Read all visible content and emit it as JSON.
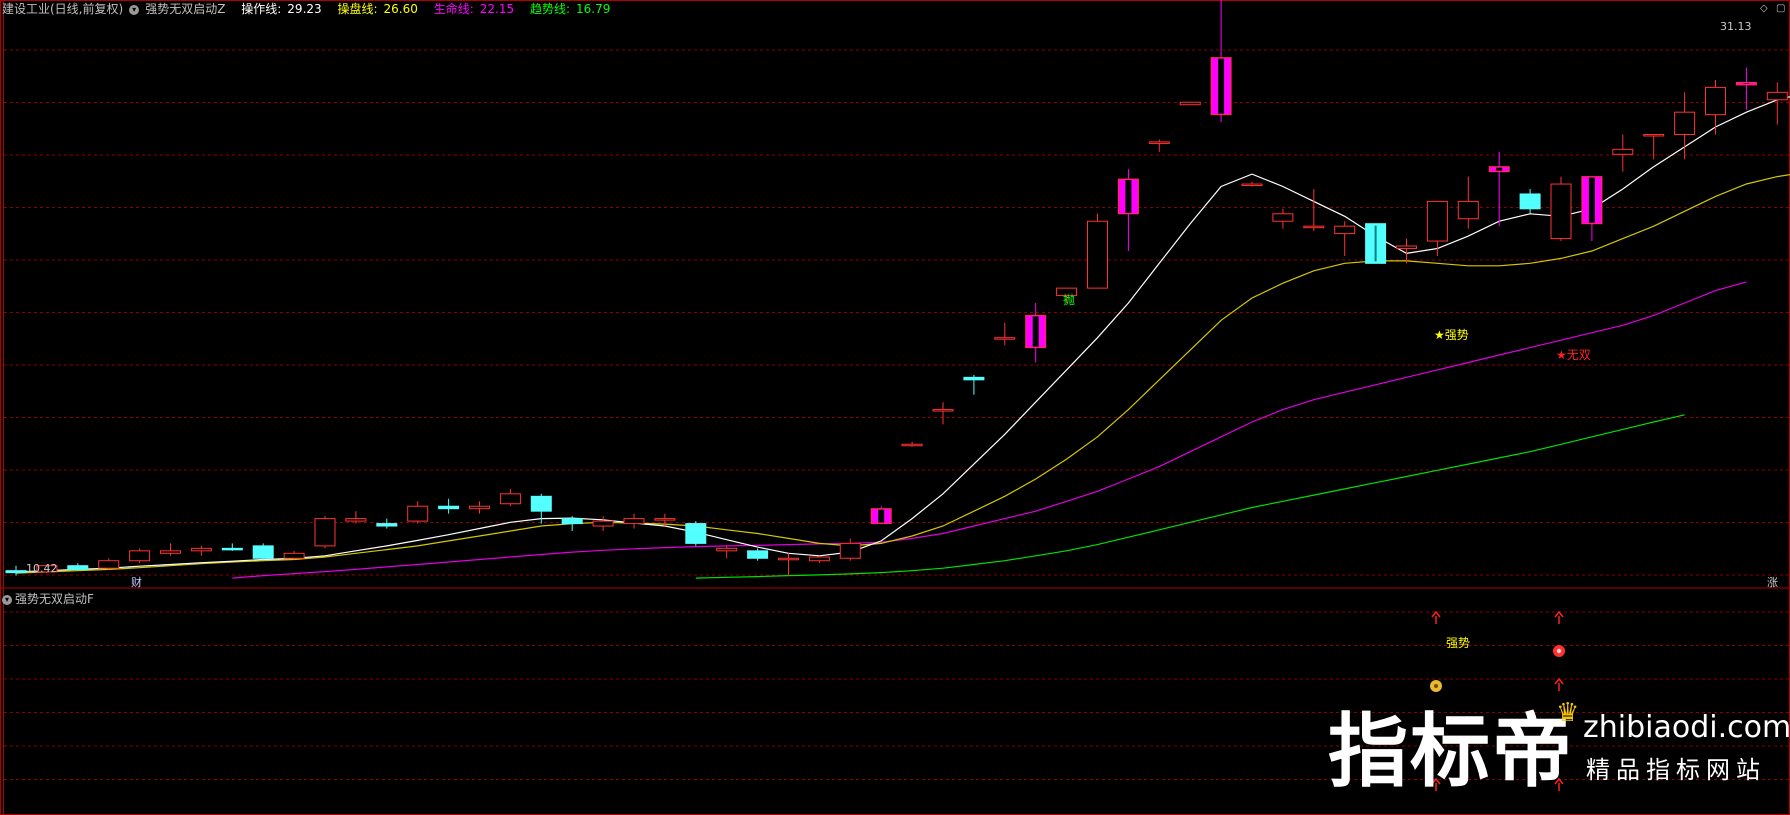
{
  "header": {
    "stock_title": "建设工业(日线,前复权)",
    "indicator_name": "强势无双启动Z",
    "lines": [
      {
        "label": "操作线:",
        "value": "29.23",
        "color": "#ffffff"
      },
      {
        "label": "操盘线:",
        "value": "26.60",
        "color": "#ffff00"
      },
      {
        "label": "生命线:",
        "value": "22.15",
        "color": "#ff00ff"
      },
      {
        "label": "趋势线:",
        "value": "16.79",
        "color": "#00ff00"
      }
    ]
  },
  "price_labels": {
    "high": "31.13",
    "low": "10.42"
  },
  "markers": {
    "cai": "财",
    "zhang": "涨",
    "pao": "抛",
    "qiangshi": "★强势",
    "wushuang": "★无双"
  },
  "sub_panel": {
    "title": "强势无双启动F",
    "qiangshi_label": "强势"
  },
  "watermark": {
    "big": "指标帝",
    "url": "zhibiaodi.com",
    "sub": "精品指标网站"
  },
  "colors": {
    "up": "#ff3232",
    "down": "#54ffff",
    "special": "#ff00ff",
    "grid": "#8b0000",
    "border": "#b00000"
  },
  "chart_data": {
    "type": "candlestick",
    "ohlc": [
      [
        10.5,
        10.7,
        10.3,
        10.42
      ],
      [
        10.45,
        10.75,
        10.4,
        10.7
      ],
      [
        10.7,
        10.8,
        10.5,
        10.55
      ],
      [
        10.6,
        11.0,
        10.55,
        10.9
      ],
      [
        10.9,
        11.4,
        10.8,
        11.3
      ],
      [
        11.2,
        11.6,
        11.1,
        11.3
      ],
      [
        11.3,
        11.5,
        11.1,
        11.4
      ],
      [
        11.4,
        11.6,
        11.3,
        11.35
      ],
      [
        11.5,
        11.6,
        10.9,
        11.0
      ],
      [
        11.0,
        11.3,
        10.95,
        11.2
      ],
      [
        11.5,
        12.7,
        11.4,
        12.6
      ],
      [
        12.5,
        12.9,
        12.4,
        12.6
      ],
      [
        12.4,
        12.6,
        12.2,
        12.3
      ],
      [
        12.5,
        13.3,
        12.4,
        13.1
      ],
      [
        13.1,
        13.4,
        12.8,
        13.0
      ],
      [
        13.0,
        13.3,
        12.8,
        13.1
      ],
      [
        13.2,
        13.8,
        13.1,
        13.6
      ],
      [
        13.5,
        13.6,
        12.4,
        12.9
      ],
      [
        12.6,
        12.7,
        12.1,
        12.4
      ],
      [
        12.3,
        12.7,
        12.1,
        12.5
      ],
      [
        12.4,
        12.8,
        12.2,
        12.6
      ],
      [
        12.6,
        12.8,
        12.3,
        12.6
      ],
      [
        12.4,
        12.5,
        11.5,
        11.6
      ],
      [
        11.3,
        11.5,
        11.0,
        11.4
      ],
      [
        11.3,
        11.4,
        10.9,
        11.0
      ],
      [
        11.0,
        11.2,
        10.3,
        11.0
      ],
      [
        10.9,
        11.1,
        10.8,
        11.05
      ],
      [
        11.0,
        11.8,
        10.9,
        11.6
      ],
      [
        12.4,
        13.1,
        12.4,
        13.0
      ],
      [
        15.6,
        15.7,
        15.5,
        15.6
      ],
      [
        17.0,
        17.3,
        16.4,
        17.0
      ],
      [
        18.3,
        18.4,
        17.6,
        18.2
      ],
      [
        19.9,
        20.5,
        19.6,
        19.9
      ],
      [
        19.5,
        21.3,
        18.9,
        20.8
      ],
      [
        21.6,
        21.9,
        21.3,
        21.9
      ],
      [
        21.9,
        24.9,
        21.9,
        24.6
      ],
      [
        24.9,
        26.7,
        23.4,
        26.3
      ],
      [
        27.8,
        27.9,
        27.4,
        27.8
      ],
      [
        29.3,
        29.4,
        29.3,
        29.4
      ],
      [
        31.2,
        33.7,
        28.6,
        28.9
      ],
      [
        26.1,
        26.2,
        26.0,
        26.1
      ],
      [
        24.6,
        25.1,
        24.3,
        24.9
      ],
      [
        24.4,
        25.9,
        24.2,
        24.4
      ],
      [
        24.1,
        24.6,
        23.2,
        24.4
      ],
      [
        24.5,
        24.5,
        22.9,
        22.9
      ],
      [
        23.5,
        23.9,
        22.9,
        23.6
      ],
      [
        23.8,
        25.3,
        23.2,
        25.4
      ],
      [
        24.7,
        26.4,
        24.3,
        25.4
      ],
      [
        26.8,
        27.4,
        24.4,
        26.6
      ],
      [
        25.7,
        25.9,
        24.9,
        25.1
      ],
      [
        23.9,
        26.4,
        23.8,
        26.1
      ],
      [
        24.5,
        26.4,
        23.8,
        26.4
      ],
      [
        27.3,
        28.1,
        26.6,
        27.5
      ],
      [
        28.1,
        28.1,
        27.1,
        28.1
      ],
      [
        28.1,
        29.8,
        27.1,
        29.0
      ],
      [
        28.9,
        30.3,
        28.1,
        30.0
      ],
      [
        30.2,
        30.8,
        29.1,
        30.1
      ],
      [
        29.5,
        30.2,
        28.5,
        29.8
      ],
      [
        29.5,
        31.1,
        29.1,
        30.2
      ]
    ],
    "special_candles": [
      28,
      33,
      36,
      39,
      48,
      51,
      56,
      58
    ],
    "lines": {
      "operation": {
        "name": "操作线",
        "start": 0,
        "values": [
          10.45,
          10.5,
          10.55,
          10.6,
          10.68,
          10.75,
          10.82,
          10.88,
          10.95,
          11.0,
          11.1,
          11.3,
          11.5,
          11.72,
          11.95,
          12.2,
          12.45,
          12.6,
          12.62,
          12.55,
          12.42,
          12.3,
          12.05,
          11.75,
          11.45,
          11.2,
          11.1,
          11.25,
          11.7,
          12.6,
          13.6,
          14.8,
          16.0,
          17.3,
          18.6,
          19.9,
          21.3,
          22.9,
          24.5,
          26.0,
          26.5,
          26.0,
          25.4,
          24.8,
          24.0,
          23.3,
          23.5,
          24.0,
          24.6,
          24.9,
          24.8,
          25.1,
          25.9,
          26.8,
          27.6,
          28.4,
          29.0,
          29.5,
          29.8
        ]
      },
      "trading": {
        "name": "操盘线",
        "start": 0,
        "values": [
          10.4,
          10.45,
          10.5,
          10.55,
          10.62,
          10.7,
          10.78,
          10.85,
          10.9,
          10.95,
          11.05,
          11.2,
          11.35,
          11.5,
          11.7,
          11.9,
          12.1,
          12.3,
          12.4,
          12.45,
          12.42,
          12.38,
          12.3,
          12.15,
          12.0,
          11.8,
          11.6,
          11.5,
          11.6,
          11.9,
          12.3,
          12.9,
          13.5,
          14.2,
          15.0,
          15.9,
          17.0,
          18.2,
          19.4,
          20.6,
          21.5,
          22.1,
          22.6,
          22.9,
          23.0,
          23.0,
          22.9,
          22.8,
          22.8,
          22.9,
          23.1,
          23.4,
          23.9,
          24.4,
          25.0,
          25.6,
          26.1,
          26.4,
          26.6
        ]
      },
      "life": {
        "name": "生命线",
        "start": 7,
        "values": [
          10.2,
          10.3,
          10.38,
          10.46,
          10.55,
          10.65,
          10.75,
          10.85,
          10.95,
          11.05,
          11.15,
          11.25,
          11.32,
          11.38,
          11.43,
          11.47,
          11.5,
          11.52,
          11.55,
          11.58,
          11.6,
          11.65,
          11.8,
          12.0,
          12.3,
          12.6,
          12.9,
          13.3,
          13.7,
          14.2,
          14.7,
          15.3,
          15.9,
          16.5,
          17.0,
          17.4,
          17.7,
          18.0,
          18.3,
          18.6,
          18.9,
          19.2,
          19.5,
          19.8,
          20.1,
          20.4,
          20.8,
          21.3,
          21.8,
          22.15
        ]
      },
      "trend": {
        "name": "趋势线",
        "start": 22,
        "values": [
          10.2,
          10.23,
          10.26,
          10.3,
          10.33,
          10.37,
          10.42,
          10.5,
          10.6,
          10.75,
          10.9,
          11.1,
          11.3,
          11.55,
          11.85,
          12.15,
          12.45,
          12.75,
          13.05,
          13.3,
          13.55,
          13.8,
          14.05,
          14.3,
          14.55,
          14.8,
          15.05,
          15.3,
          15.6,
          15.9,
          16.2,
          16.5,
          16.79
        ]
      }
    },
    "x_range": [
      0,
      58
    ],
    "ylim": [
      9.8,
      32.8
    ]
  }
}
